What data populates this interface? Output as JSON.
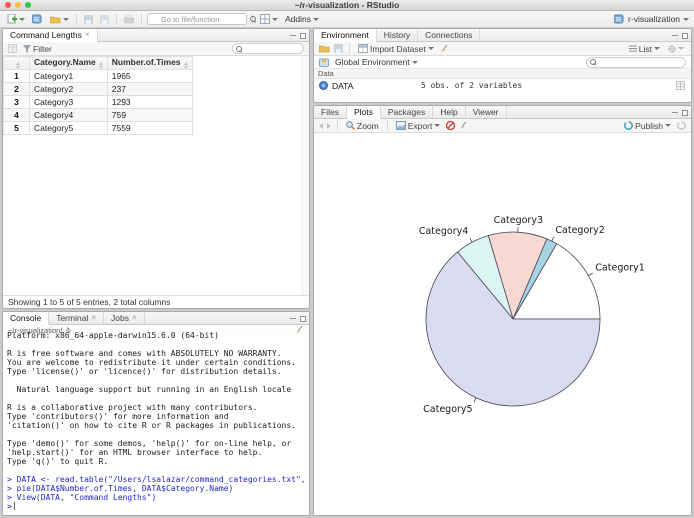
{
  "window": {
    "title": "~/r-visualization - RStudio"
  },
  "toolbar": {
    "goto_placeholder": "Go to file/function",
    "addins_label": "Addins",
    "project_label": "r-visualization"
  },
  "viewer": {
    "tab": "Command Lengths",
    "filter_label": "Filter",
    "columns": [
      "",
      "Category.Name",
      "Number.of.Times"
    ],
    "rows": [
      [
        "1",
        "Category1",
        "1965"
      ],
      [
        "2",
        "Category2",
        "237"
      ],
      [
        "3",
        "Category3",
        "1293"
      ],
      [
        "4",
        "Category4",
        "759"
      ],
      [
        "5",
        "Category5",
        "7559"
      ]
    ],
    "footer": "Showing 1 to 5 of 5 entries, 2 total columns"
  },
  "console": {
    "tabs": [
      "Console",
      "Terminal",
      "Jobs"
    ],
    "path": "~/r-visualization/",
    "lines": [
      {
        "t": "Platform: x86_64-apple-darwin15.6.0 (64-bit)",
        "c": "out"
      },
      {
        "t": "",
        "c": "out"
      },
      {
        "t": "R is free software and comes with ABSOLUTELY NO WARRANTY.",
        "c": "out"
      },
      {
        "t": "You are welcome to redistribute it under certain conditions.",
        "c": "out"
      },
      {
        "t": "Type 'license()' or 'licence()' for distribution details.",
        "c": "out"
      },
      {
        "t": "",
        "c": "out"
      },
      {
        "t": "  Natural language support but running in an English locale",
        "c": "out"
      },
      {
        "t": "",
        "c": "out"
      },
      {
        "t": "R is a collaborative project with many contributors.",
        "c": "out"
      },
      {
        "t": "Type 'contributors()' for more information and",
        "c": "out"
      },
      {
        "t": "'citation()' on how to cite R or R packages in publications.",
        "c": "out"
      },
      {
        "t": "",
        "c": "out"
      },
      {
        "t": "Type 'demo()' for some demos, 'help()' for on-line help, or",
        "c": "out"
      },
      {
        "t": "'help.start()' for an HTML browser interface to help.",
        "c": "out"
      },
      {
        "t": "Type 'q()' to quit R.",
        "c": "out"
      },
      {
        "t": "",
        "c": "out"
      },
      {
        "t": "> DATA <- read.table(\"/Users/lsalazar/command_categories.txt\", header=TRUE)",
        "c": "cmd"
      },
      {
        "t": "> pie(DATA$Number.of.Times, DATA$Category.Name)",
        "c": "cmd"
      },
      {
        "t": "> View(DATA, \"Command Lengths\")",
        "c": "cmd"
      },
      {
        "t": ">",
        "c": "prompt"
      }
    ]
  },
  "environment": {
    "tabs": [
      "Environment",
      "History",
      "Connections"
    ],
    "import_label": "Import Dataset",
    "list_label": "List",
    "scope_label": "Global Environment",
    "section_label": "Data",
    "object_name": "DATA",
    "object_desc": "5 obs. of 2 variables"
  },
  "plots": {
    "tabs": [
      "Files",
      "Plots",
      "Packages",
      "Help",
      "Viewer"
    ],
    "zoom_label": "Zoom",
    "export_label": "Export",
    "publish_label": "Publish"
  },
  "colors": {
    "command_blue": "#2626c9",
    "pie_stroke": "#45455a"
  },
  "chart_data": {
    "type": "pie",
    "title": "",
    "categories": [
      "Category1",
      "Category2",
      "Category3",
      "Category4",
      "Category5"
    ],
    "values": [
      1965,
      237,
      1293,
      759,
      7559
    ],
    "colors": [
      "#ffffff",
      "#a8d3e2",
      "#f9d8d3",
      "#ddf6f4",
      "#dcdcf0"
    ],
    "stroke": "#45455a",
    "start_angle_deg": 0,
    "direction": "ccw",
    "legend": "none",
    "labels_outside": true
  }
}
